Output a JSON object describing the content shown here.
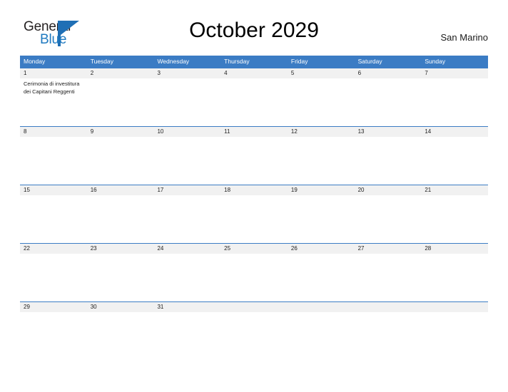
{
  "brand": {
    "name_part1": "General",
    "name_part2": "Blue",
    "triangle_icon": "triangle-icon",
    "accent_color": "#1f6fb5"
  },
  "header": {
    "title": "October 2029",
    "location": "San Marino"
  },
  "colors": {
    "header_blue": "#3b7cc4",
    "date_band_gray": "#f1f1f1",
    "text_dark": "#1c1c1c",
    "logo_blue": "#1f7ac0"
  },
  "calendar": {
    "month": "October",
    "year": "2029",
    "weekdays": [
      "Monday",
      "Tuesday",
      "Wednesday",
      "Thursday",
      "Friday",
      "Saturday",
      "Sunday"
    ],
    "weeks": [
      {
        "dates": [
          "1",
          "2",
          "3",
          "4",
          "5",
          "6",
          "7"
        ],
        "events": [
          [
            "Cerimonia di investitura dei Capitani Reggenti"
          ],
          [],
          [],
          [],
          [],
          [],
          []
        ]
      },
      {
        "dates": [
          "8",
          "9",
          "10",
          "11",
          "12",
          "13",
          "14"
        ],
        "events": [
          [],
          [],
          [],
          [],
          [],
          [],
          []
        ]
      },
      {
        "dates": [
          "15",
          "16",
          "17",
          "18",
          "19",
          "20",
          "21"
        ],
        "events": [
          [],
          [],
          [],
          [],
          [],
          [],
          []
        ]
      },
      {
        "dates": [
          "22",
          "23",
          "24",
          "25",
          "26",
          "27",
          "28"
        ],
        "events": [
          [],
          [],
          [],
          [],
          [],
          [],
          []
        ]
      },
      {
        "dates": [
          "29",
          "30",
          "31",
          "",
          "",
          "",
          ""
        ],
        "events": [
          [],
          [],
          [],
          [],
          [],
          [],
          []
        ]
      }
    ]
  }
}
